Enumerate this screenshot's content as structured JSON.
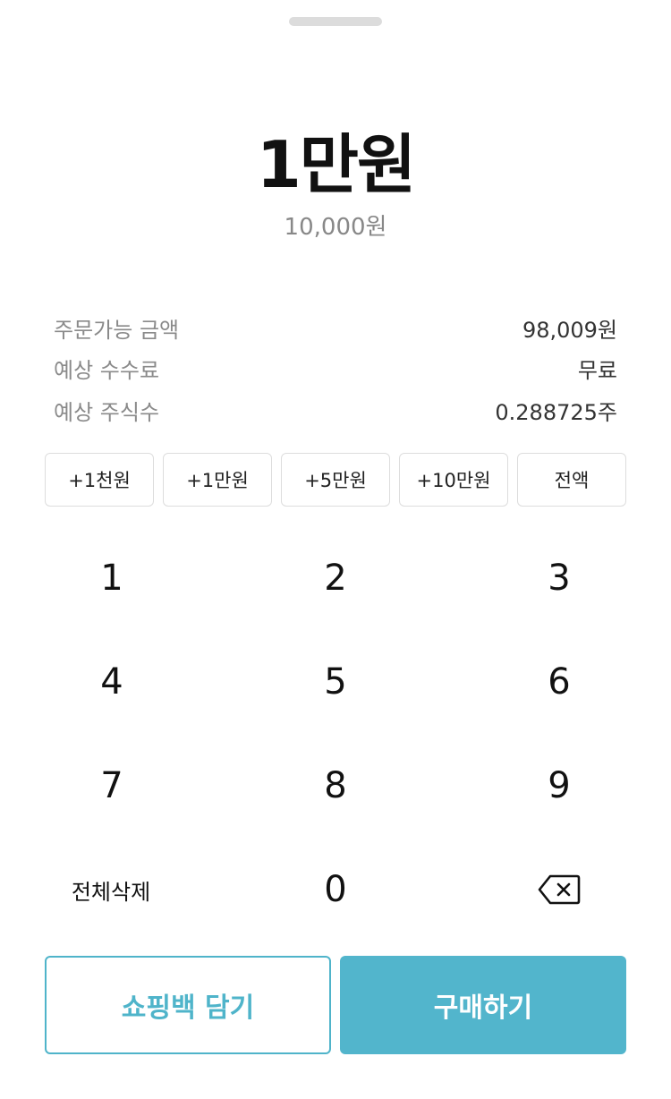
{
  "amount": {
    "display": "1만원",
    "exact": "10,000원"
  },
  "info": [
    {
      "label": "주문가능 금액",
      "value": "98,009원"
    },
    {
      "label": "예상 수수료",
      "value": "무료"
    },
    {
      "label": "예상 주식수",
      "value": "0.288725주"
    }
  ],
  "quick_buttons": [
    "+1천원",
    "+1만원",
    "+5만원",
    "+10만원",
    "전액"
  ],
  "keypad": {
    "keys": [
      "1",
      "2",
      "3",
      "4",
      "5",
      "6",
      "7",
      "8",
      "9"
    ],
    "clear_label": "전체삭제",
    "zero": "0",
    "backspace_icon": "backspace-icon"
  },
  "actions": {
    "cart_label": "쇼핑백 담기",
    "buy_label": "구매하기"
  },
  "colors": {
    "accent": "#52b5cc",
    "accent_border": "#4fb4ca"
  }
}
